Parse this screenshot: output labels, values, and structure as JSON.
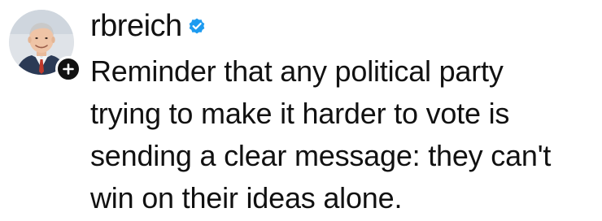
{
  "post": {
    "username": "rbreich",
    "verified": true,
    "avatar_icon": "avatar-photo",
    "follow_icon": "plus-icon",
    "verified_icon": "verified-badge-icon",
    "text_lines": [
      "Reminder that any political party",
      "trying to make it harder to vote is",
      "sending a clear message: they can't",
      "win on their ideas alone."
    ]
  },
  "colors": {
    "verified_badge": "#1d9bf0",
    "text": "#111111",
    "background": "#ffffff"
  }
}
